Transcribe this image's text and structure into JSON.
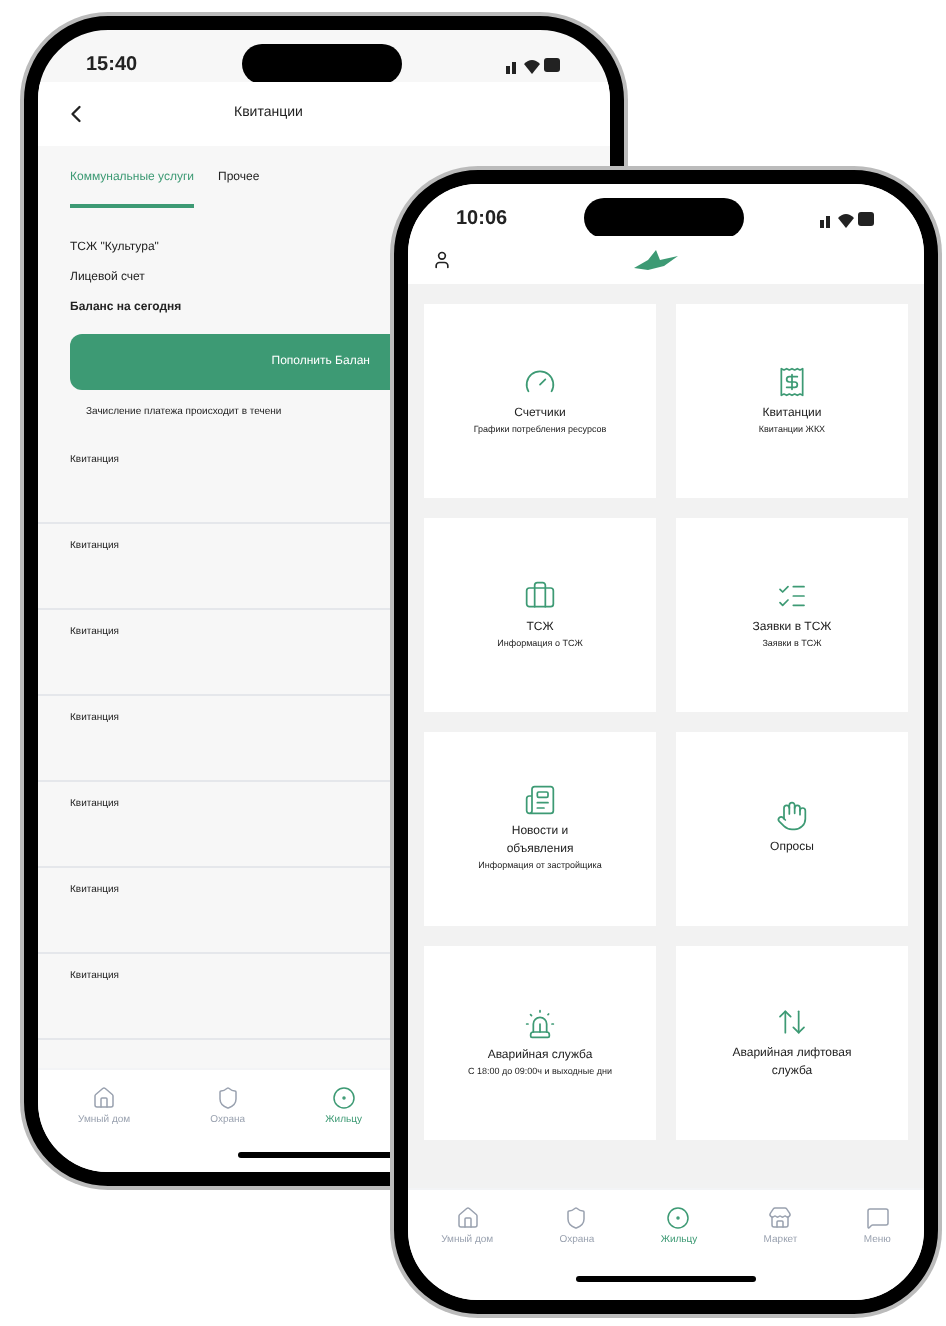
{
  "left_phone": {
    "time": "15:40",
    "title": "Квитанции",
    "tabs": [
      {
        "label": "Коммунальные услуги",
        "selected": true
      },
      {
        "label": "Прочее",
        "selected": false
      }
    ],
    "org": "ТСЖ \"Культура\"",
    "account": "Лицевой счет",
    "balance": "Баланс на сегодня",
    "topup_button": "Пополнить Балан",
    "note": "Зачисление платежа происходит в течени",
    "receipts": [
      "Квитанция",
      "Квитанция",
      "Квитанция",
      "Квитанция",
      "Квитанция",
      "Квитанция",
      "Квитанция"
    ],
    "nav": [
      {
        "label": "Умный дом",
        "selected": false
      },
      {
        "label": "Охрана",
        "selected": false
      },
      {
        "label": "Жильцу",
        "selected": true
      }
    ]
  },
  "right_phone": {
    "time": "10:06",
    "cards": [
      {
        "title": "Счетчики",
        "subtitle": "Графики потребления ресурсов"
      },
      {
        "title": "Квитанции",
        "subtitle": "Квитанции ЖКХ"
      },
      {
        "title": "ТСЖ",
        "subtitle": "Информация о ТСЖ"
      },
      {
        "title": "Заявки в ТСЖ",
        "subtitle": "Заявки в ТСЖ"
      },
      {
        "title": "Новости и объявления",
        "subtitle": "Информация от застройщика"
      },
      {
        "title": "Опросы"
      },
      {
        "title": "Аварийная служба",
        "subtitle": "С 18:00 до 09:00ч и выходные дни"
      },
      {
        "title": "Аварийная лифтовая служба"
      }
    ],
    "nav": [
      {
        "label": "Умный дом",
        "selected": false
      },
      {
        "label": "Охрана",
        "selected": false
      },
      {
        "label": "Жильцу",
        "selected": true
      },
      {
        "label": "Маркет",
        "selected": false
      },
      {
        "label": "Меню",
        "selected": false
      }
    ]
  }
}
